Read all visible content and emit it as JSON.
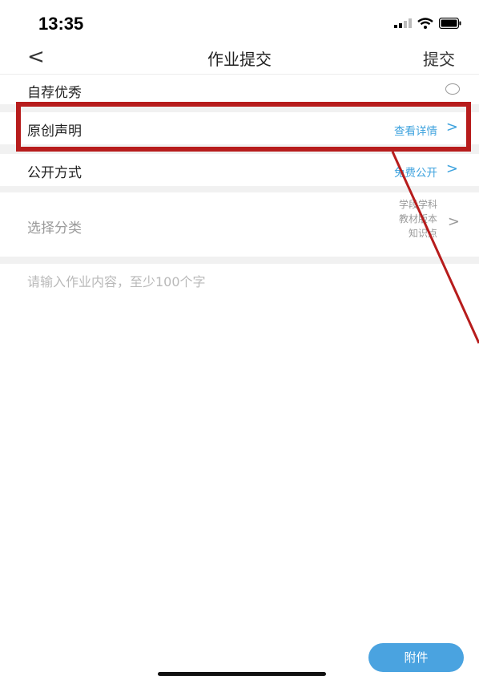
{
  "status_bar": {
    "time": "13:35"
  },
  "nav": {
    "back_symbol": "<",
    "title": "作业提交",
    "submit_label": "提交"
  },
  "rows": {
    "recommend_label": "自荐优秀",
    "original_label": "原创声明",
    "original_value": "查看详情",
    "public_label": "公开方式",
    "public_value": "免费公开",
    "category_label": "选择分类",
    "category_lines": [
      "学段学科",
      "教材版本",
      "知识点"
    ]
  },
  "chevron": ">",
  "content": {
    "placeholder": "请输入作业内容，至少100个字"
  },
  "attach_label": "附件",
  "colors": {
    "accent": "#3fa3de",
    "annotation": "#b71c1c",
    "button": "#4aa3e0"
  }
}
